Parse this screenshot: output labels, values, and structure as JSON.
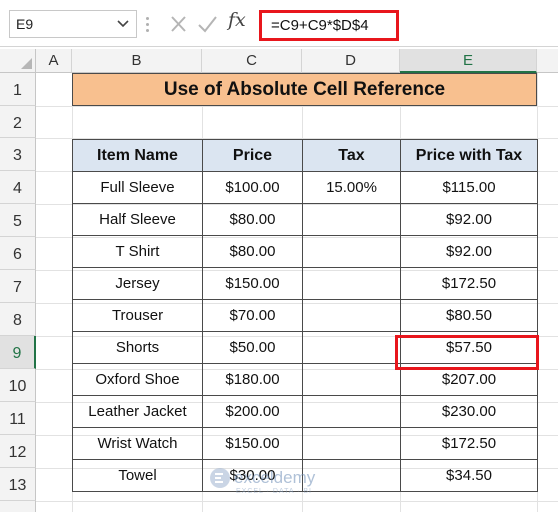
{
  "formula_bar": {
    "name_box": "E9",
    "formula": "=C9+C9*$D$4",
    "fx_label": "fx",
    "icons": [
      "chevron-down-icon",
      "cancel-icon",
      "enter-check-icon",
      "function-icon"
    ]
  },
  "columns": [
    "A",
    "B",
    "C",
    "D",
    "E"
  ],
  "rows": [
    "1",
    "2",
    "3",
    "4",
    "5",
    "6",
    "7",
    "8",
    "9",
    "10",
    "11",
    "12",
    "13"
  ],
  "selected_cell": {
    "column": "E",
    "row": "9"
  },
  "title": "Use of Absolute Cell Reference",
  "table": {
    "headers": [
      "Item Name",
      "Price",
      "Tax",
      "Price with Tax"
    ],
    "rows": [
      [
        "Full Sleeve",
        "$100.00",
        "15.00%",
        "$115.00"
      ],
      [
        "Half Sleeve",
        "$80.00",
        "",
        "$92.00"
      ],
      [
        "T Shirt",
        "$80.00",
        "",
        "$92.00"
      ],
      [
        "Jersey",
        "$150.00",
        "",
        "$172.50"
      ],
      [
        "Trouser",
        "$70.00",
        "",
        "$80.50"
      ],
      [
        "Shorts",
        "$50.00",
        "",
        "$57.50"
      ],
      [
        "Oxford Shoe",
        "$180.00",
        "",
        "$207.00"
      ],
      [
        "Leather Jacket",
        "$200.00",
        "",
        "$230.00"
      ],
      [
        "Wrist Watch",
        "$150.00",
        "",
        "$172.50"
      ],
      [
        "Towel",
        "$30.00",
        "",
        "$34.50"
      ]
    ]
  },
  "watermark": {
    "name": "exceldemy",
    "tagline": "EXCEL · DATA · BI"
  },
  "colors": {
    "title_fill": "#f8c08f",
    "header_fill": "#dbe5f1",
    "highlight": "#e8161c",
    "selection_green": "#217346"
  }
}
